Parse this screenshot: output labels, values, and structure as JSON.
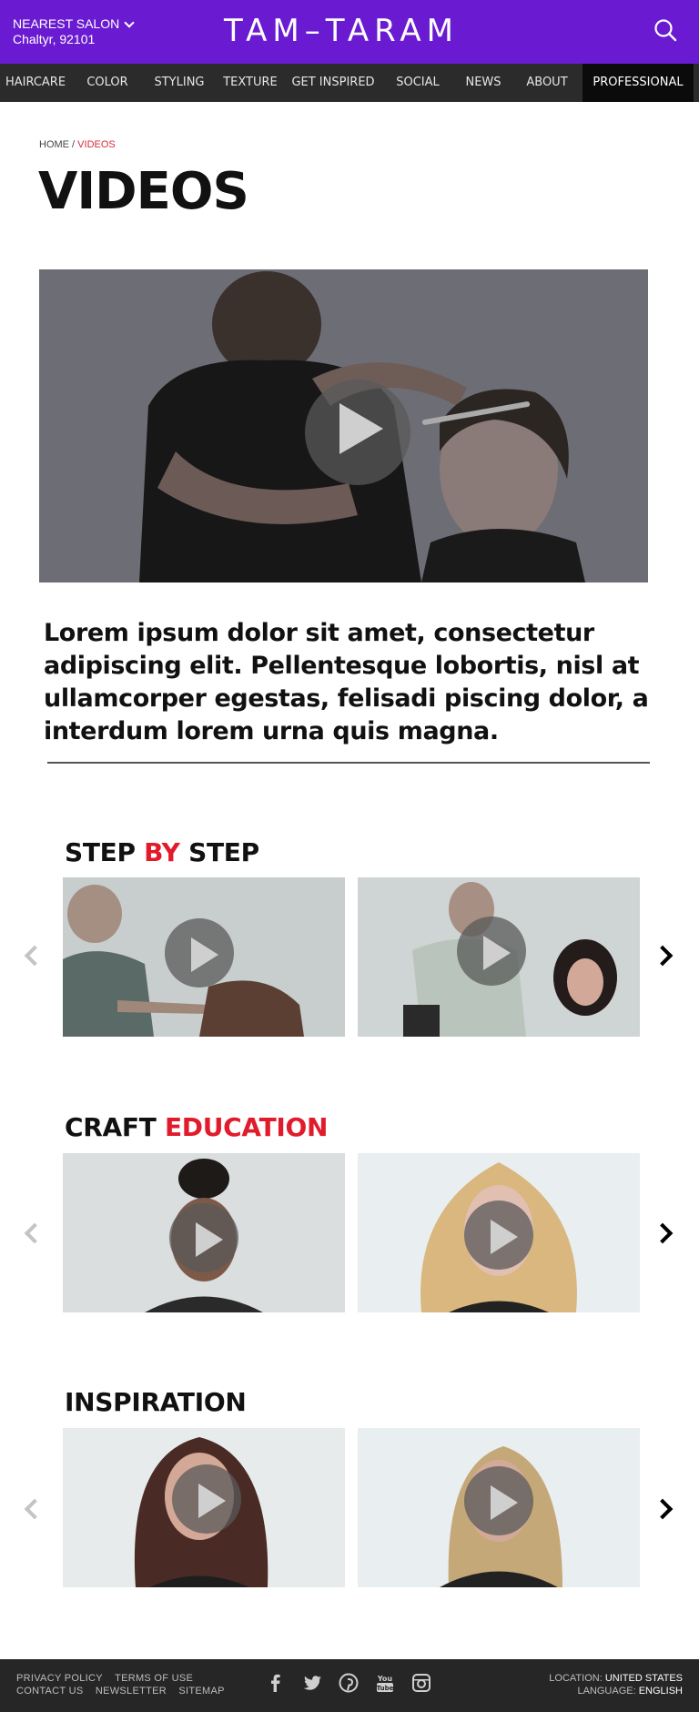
{
  "header": {
    "salon_label": "NEAREST SALON",
    "salon_location": "Chaltyr, 92101",
    "logo": "TAM–TARAM",
    "brand_color": "#6a1bd1"
  },
  "nav": {
    "items": [
      "HAIRCARE",
      "COLOR",
      "STYLING",
      "TEXTURE",
      "GET INSPIRED",
      "SOCIAL",
      "NEWS",
      "ABOUT",
      "PROFESSIONAL"
    ]
  },
  "breadcrumb": {
    "home": "HOME",
    "separator": " / ",
    "current": "VIDEOS"
  },
  "page_title": "VIDEOS",
  "intro_text": "Lorem ipsum dolor sit amet, consectetur adipiscing elit. Pellentesque lobortis, nisl at ullamcorper egestas, felisadi piscing dolor, a interdum lorem urna quis magna.",
  "sections": [
    {
      "title_a": "STEP ",
      "title_b": "BY",
      "title_c": " STEP"
    },
    {
      "title_a": "CRAFT ",
      "title_b": "EDUCATION",
      "title_c": ""
    },
    {
      "title_a": "INSPIRATION",
      "title_b": "",
      "title_c": ""
    }
  ],
  "footer": {
    "links_row1": [
      "PRIVACY POLICY",
      "TERMS OF USE"
    ],
    "links_row2": [
      "CONTACT US",
      "NEWSLETTER",
      "SITEMAP"
    ],
    "location_label": "LOCATION:",
    "location_value": "UNITED STATES",
    "language_label": "LANGUAGE:",
    "language_value": "ENGLISH",
    "social_icons": [
      "facebook-icon",
      "twitter-icon",
      "pinterest-icon",
      "youtube-icon",
      "instagram-icon"
    ]
  },
  "accent_color": "#e11b2b"
}
